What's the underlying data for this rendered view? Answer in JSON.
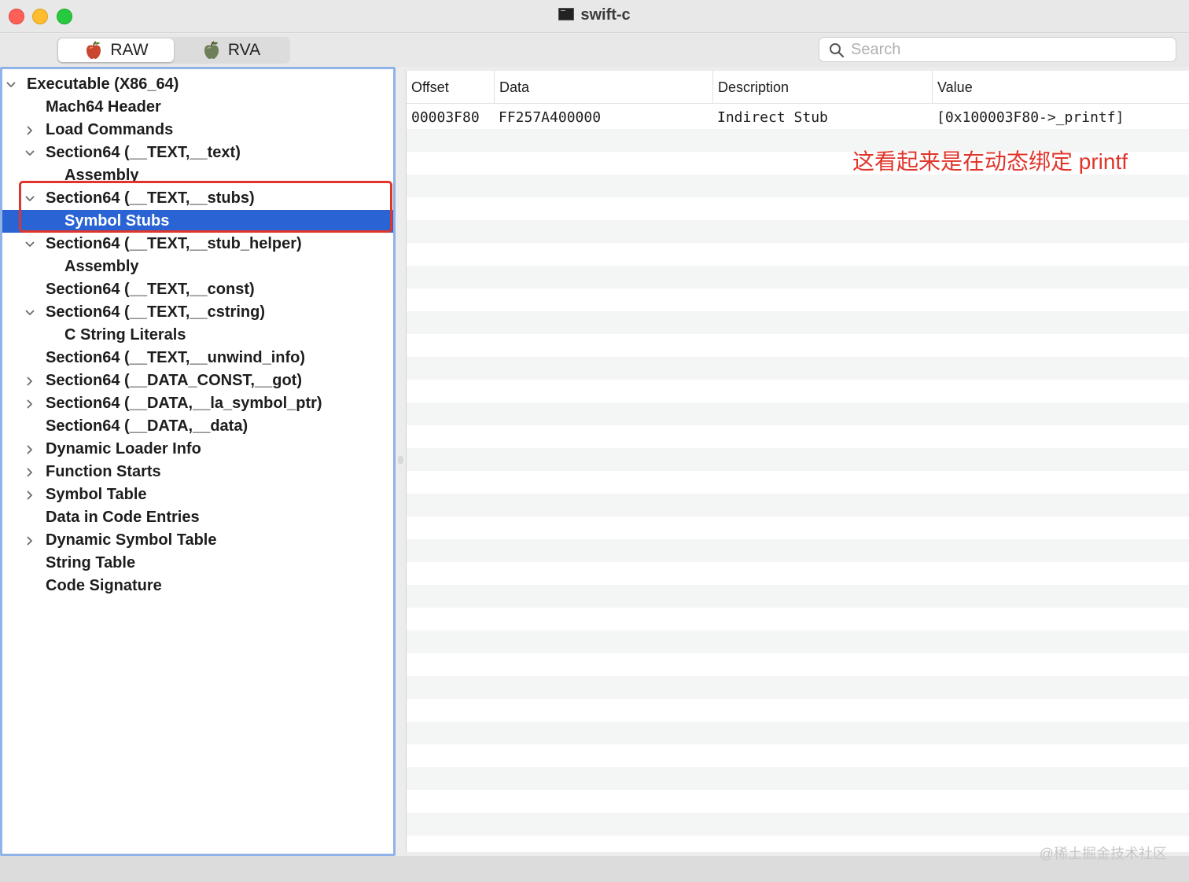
{
  "window": {
    "title": "swift-c"
  },
  "toolbar": {
    "modes": [
      {
        "label": "RAW",
        "icon": "apple-icon",
        "selected": true
      },
      {
        "label": "RVA",
        "icon": "apple-icon",
        "selected": false
      }
    ],
    "search": {
      "placeholder": "Search",
      "value": ""
    }
  },
  "sidebar": {
    "items": [
      {
        "label": "Executable  (X86_64)",
        "depth": 0,
        "chevron": "down"
      },
      {
        "label": "Mach64 Header",
        "depth": 1,
        "chevron": "none"
      },
      {
        "label": "Load Commands",
        "depth": 1,
        "chevron": "right"
      },
      {
        "label": "Section64 (__TEXT,__text)",
        "depth": 1,
        "chevron": "down"
      },
      {
        "label": "Assembly",
        "depth": 2,
        "chevron": "none"
      },
      {
        "label": "Section64 (__TEXT,__stubs)",
        "depth": 1,
        "chevron": "down"
      },
      {
        "label": "Symbol Stubs",
        "depth": 2,
        "chevron": "none",
        "selected": true
      },
      {
        "label": "Section64 (__TEXT,__stub_helper)",
        "depth": 1,
        "chevron": "down"
      },
      {
        "label": "Assembly",
        "depth": 2,
        "chevron": "none"
      },
      {
        "label": "Section64 (__TEXT,__const)",
        "depth": 1,
        "chevron": "none"
      },
      {
        "label": "Section64 (__TEXT,__cstring)",
        "depth": 1,
        "chevron": "down"
      },
      {
        "label": "C String Literals",
        "depth": 2,
        "chevron": "none"
      },
      {
        "label": "Section64 (__TEXT,__unwind_info)",
        "depth": 1,
        "chevron": "none"
      },
      {
        "label": "Section64 (__DATA_CONST,__got)",
        "depth": 1,
        "chevron": "right"
      },
      {
        "label": "Section64 (__DATA,__la_symbol_ptr)",
        "depth": 1,
        "chevron": "right"
      },
      {
        "label": "Section64 (__DATA,__data)",
        "depth": 1,
        "chevron": "none"
      },
      {
        "label": "Dynamic Loader Info",
        "depth": 1,
        "chevron": "right"
      },
      {
        "label": "Function Starts",
        "depth": 1,
        "chevron": "right"
      },
      {
        "label": "Symbol Table",
        "depth": 1,
        "chevron": "right"
      },
      {
        "label": "Data in Code Entries",
        "depth": 1,
        "chevron": "none"
      },
      {
        "label": "Dynamic Symbol Table",
        "depth": 1,
        "chevron": "right"
      },
      {
        "label": "String Table",
        "depth": 1,
        "chevron": "none"
      },
      {
        "label": "Code Signature",
        "depth": 1,
        "chevron": "none"
      }
    ]
  },
  "table": {
    "columns": [
      "Offset",
      "Data",
      "Description",
      "Value"
    ],
    "rows": [
      {
        "offset": "00003F80",
        "data": "FF257A400000",
        "description": "Indirect Stub",
        "value": "[0x100003F80->_printf]"
      }
    ]
  },
  "annotation": {
    "text": "这看起来是在动态绑定 printf",
    "color": "#e0352b"
  },
  "watermark": "@稀土掘金技术社区",
  "colors": {
    "selection": "#2a63d3",
    "sidebar_border": "#8fb2e8",
    "highlight_box": "#e0352b"
  }
}
